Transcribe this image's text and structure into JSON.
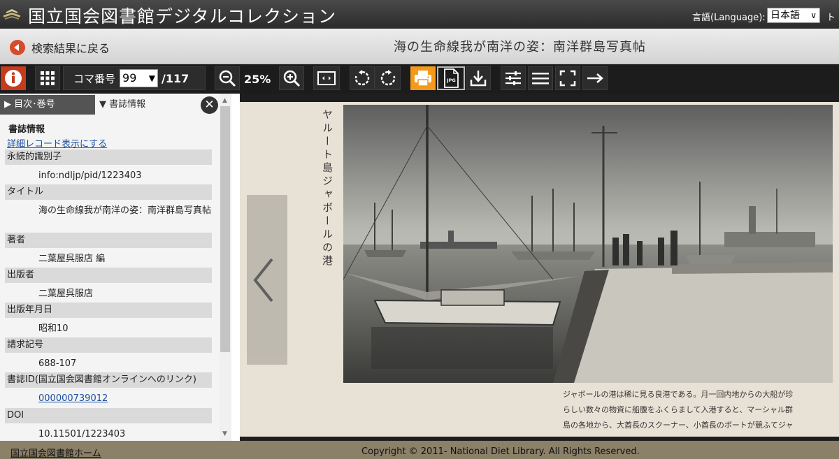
{
  "header": {
    "site_title": "国立国会図書館デジタルコレクション",
    "language_label": "言語(Language):",
    "language_selected": "日本語",
    "extra": "ト"
  },
  "titlebar": {
    "back_label": "検索結果に戻る",
    "book_title": "海の生命線我が南洋の姿：南洋群島写真帖"
  },
  "toolbar": {
    "page_label": "コマ番号",
    "page_value": "99",
    "page_total": "/117",
    "zoom": "25%",
    "jpg_label": "JPG"
  },
  "panel": {
    "tab_toc": "▶ 目次･巻号",
    "tab_biblio": "▼ 書誌情報",
    "heading": "書誌情報",
    "detail_link": "詳細レコード表示にする",
    "fields": [
      {
        "label": "永続的識別子",
        "value": "info:ndljp/pid/1223403"
      },
      {
        "label": "タイトル",
        "value": "海の生命線我が南洋の姿：南洋群島写真帖"
      },
      {
        "label": "著者",
        "value": "二葉屋呉服店 編"
      },
      {
        "label": "出版者",
        "value": "二葉屋呉服店"
      },
      {
        "label": "出版年月日",
        "value": "昭和10"
      },
      {
        "label": "請求記号",
        "value": "688-107"
      },
      {
        "label": "書誌ID(国立国会図書館オンラインへのリンク)",
        "value": "000000739012"
      },
      {
        "label": "DOI",
        "value": "10.11501/1223403"
      }
    ]
  },
  "viewer": {
    "vertical_caption": "ヤルート島ジャボールの港",
    "caption_lines": [
      "ジャボールの港は稀に見る良港である。月一回内地からの大船が珍",
      "らしい数々の物資に船腹をふくらまして入港すると、マーシャル群",
      "島の各地から、大酋長のスクーナー、小酋長のボートが競ふてジャ"
    ]
  },
  "footer": {
    "home_link": "国立国会図書館ホーム",
    "copyright": "Copyright © 2011- National Diet Library. All Rights Reserved."
  },
  "colors": {
    "info_button": "#c63b1e",
    "print_button_active": "#f39a1b",
    "footer": "#8b8068"
  }
}
